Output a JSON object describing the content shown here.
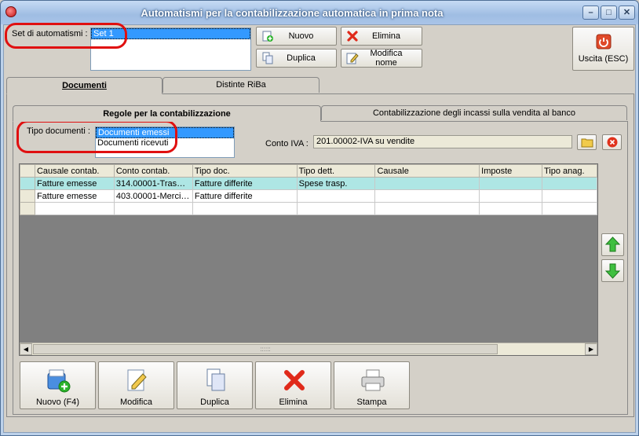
{
  "window": {
    "title": "Automatismi per la contabilizzazione automatica in prima nota"
  },
  "set_area": {
    "label": "Set di automatismi :",
    "items": [
      "Set 1"
    ],
    "selected": 0
  },
  "buttons": {
    "nuovo": "Nuovo",
    "elimina": "Elimina",
    "duplica": "Duplica",
    "modifica_nome": "Modifica nome",
    "uscita": "Uscita (ESC)"
  },
  "main_tabs": [
    "Documenti",
    "Distinte RiBa"
  ],
  "sub_tabs": [
    "Regole per la contabilizzazione",
    "Contabilizzazione degli incassi sulla vendita al banco"
  ],
  "tipo_documenti": {
    "label": "Tipo documenti :",
    "items": [
      "Documenti emessi",
      "Documenti ricevuti"
    ],
    "selected": 0
  },
  "conto_iva": {
    "label": "Conto IVA :",
    "value": "201.00002-IVA su vendite"
  },
  "grid": {
    "columns": [
      "Causale contab.",
      "Conto contab.",
      "Tipo doc.",
      "Tipo dett.",
      "Causale",
      "Imposte",
      "Tipo anag."
    ],
    "rows": [
      [
        "Fatture emesse",
        "314.00001-Tras…",
        "Fatture differite",
        "Spese trasp.",
        "",
        "",
        ""
      ],
      [
        "Fatture emesse",
        "403.00001-Merci…",
        "Fatture differite",
        "",
        "",
        "",
        ""
      ],
      [
        "",
        "",
        "",
        "",
        "",
        "",
        ""
      ]
    ],
    "highlighted_row": 0
  },
  "bottom_buttons": {
    "nuovo": "Nuovo (F4)",
    "modifica": "Modifica",
    "duplica": "Duplica",
    "elimina": "Elimina",
    "stampa": "Stampa"
  },
  "colors": {
    "highlight_row": "#aee6e4",
    "selection": "#3399ff",
    "annotation_ring": "#e01010"
  }
}
